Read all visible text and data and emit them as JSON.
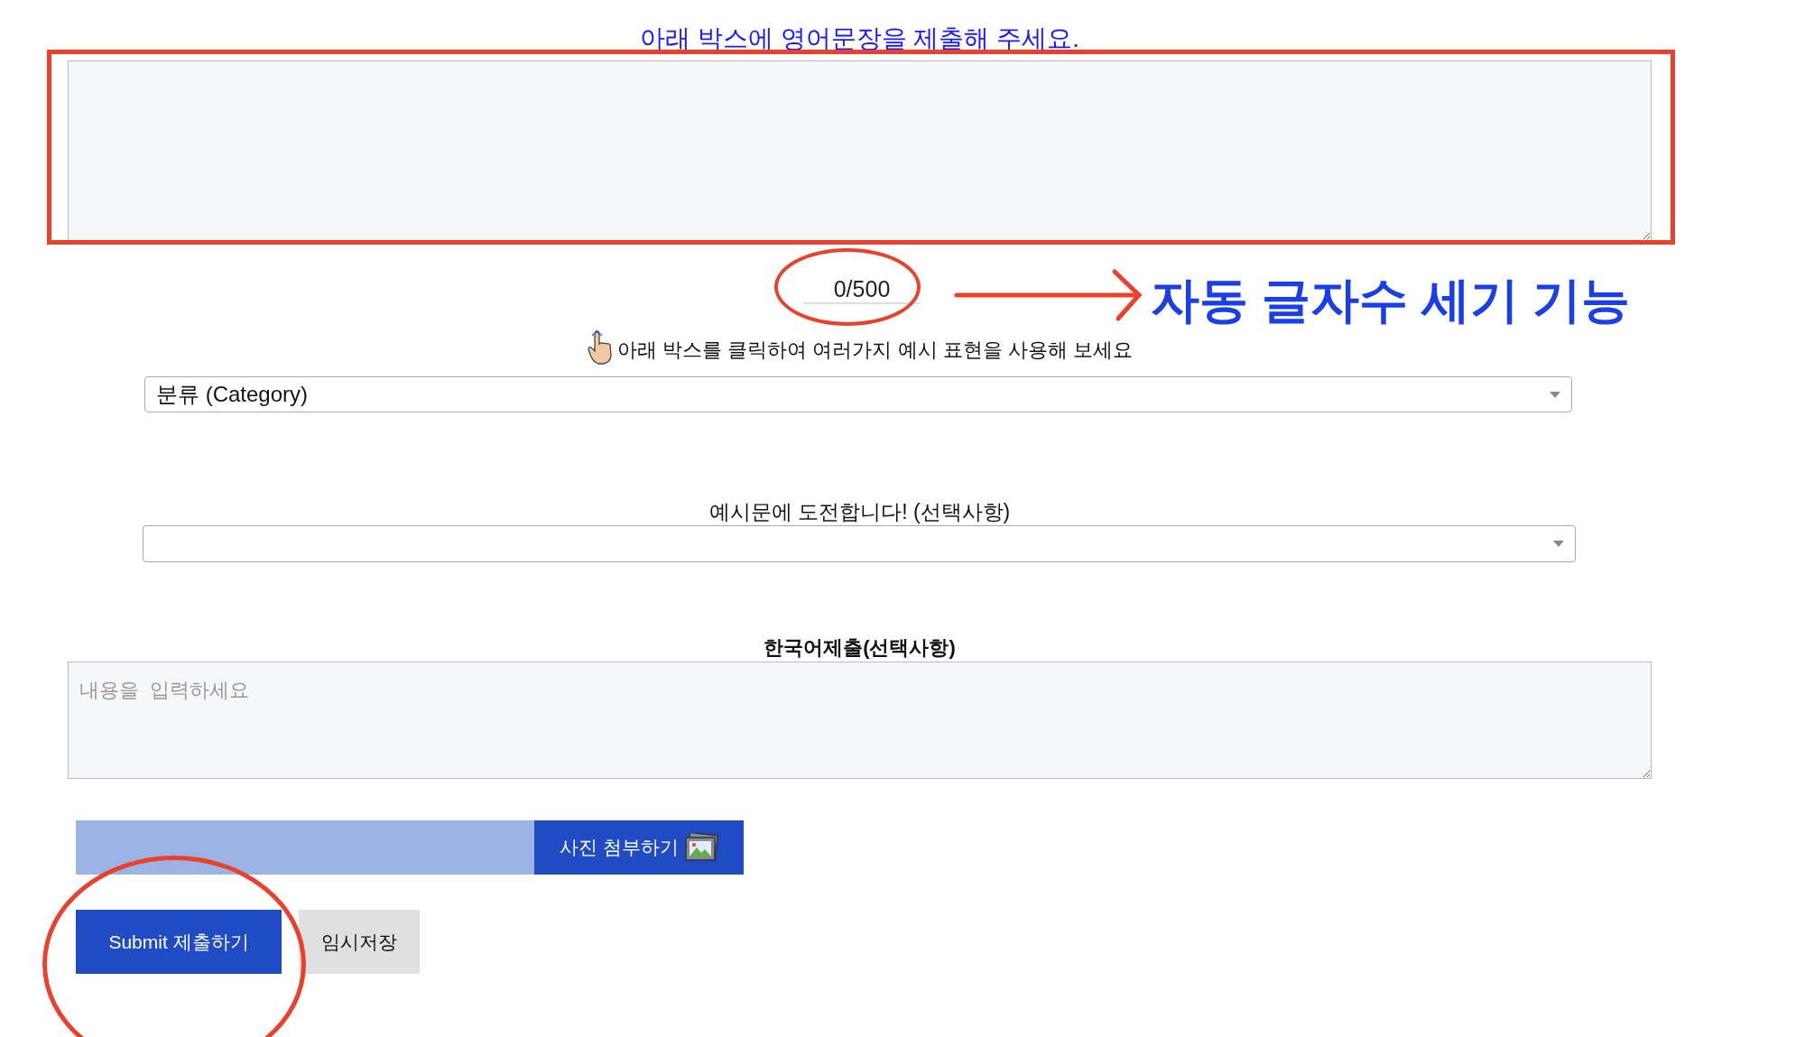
{
  "heading": "아래 박스에 영어문장을 제출해 주세요.",
  "counter": "0/500",
  "callout": "자동 글자수 세기 기능",
  "hint": "아래 박스를 클릭하여 여러가지 예시 표현을 사용해 보세요",
  "category_select": {
    "value": "분류 (Category)"
  },
  "example_select": {
    "label": "예시문에 도전합니다! (선택사항)"
  },
  "korean": {
    "label": "한국어제출(선택사항)",
    "placeholder": "내용을  입력하세요"
  },
  "attach_button": "사진 첨부하기",
  "buttons": [
    {
      "label": "Submit 제출하기",
      "kind": "primary"
    },
    {
      "label": "임시저장",
      "kind": "secondary"
    }
  ]
}
